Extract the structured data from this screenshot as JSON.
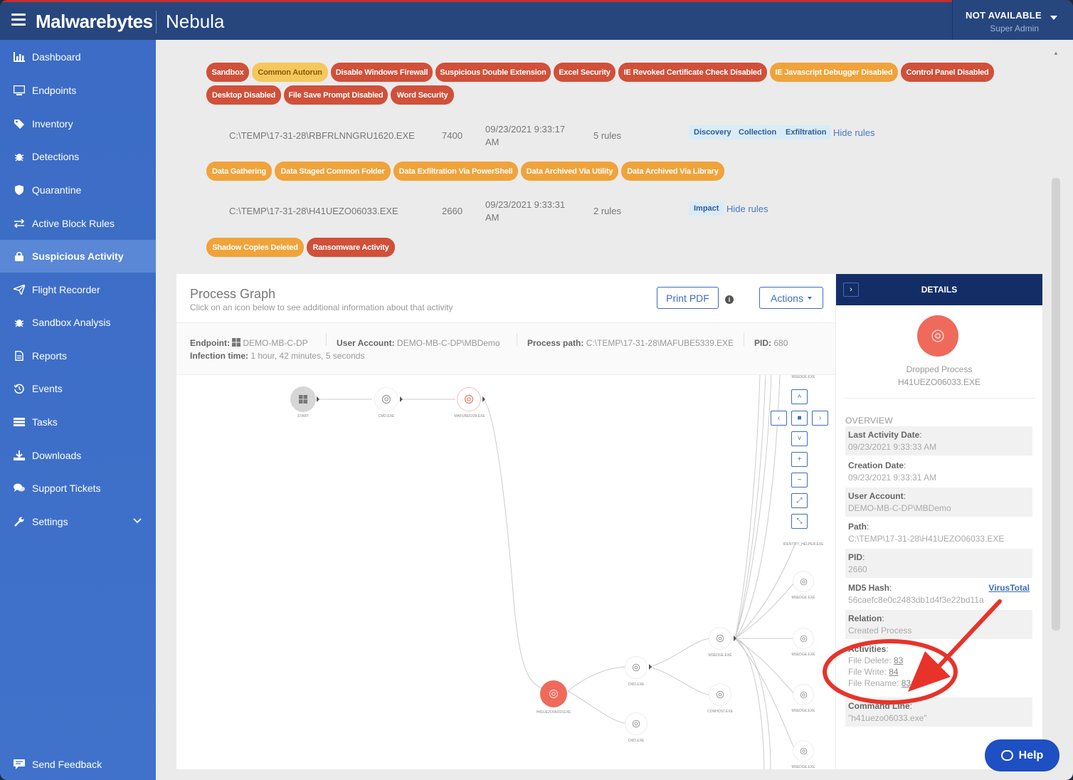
{
  "app": {
    "brand": "Malwarebytes",
    "product": "Nebula"
  },
  "user": {
    "name": "NOT AVAILABLE",
    "role": "Super Admin"
  },
  "sidebar": {
    "items": [
      {
        "label": "Dashboard",
        "icon": "chart-icon",
        "active": false
      },
      {
        "label": "Endpoints",
        "icon": "monitor-icon",
        "active": false
      },
      {
        "label": "Inventory",
        "icon": "tag-icon",
        "active": false
      },
      {
        "label": "Detections",
        "icon": "bug-icon",
        "active": false
      },
      {
        "label": "Quarantine",
        "icon": "shield-icon",
        "active": false
      },
      {
        "label": "Active Block Rules",
        "icon": "arrows-icon",
        "active": false
      },
      {
        "label": "Suspicious Activity",
        "icon": "lock-icon",
        "active": true
      },
      {
        "label": "Flight Recorder",
        "icon": "paper-plane-icon",
        "active": false
      },
      {
        "label": "Sandbox Analysis",
        "icon": "bug-icon",
        "active": false
      },
      {
        "label": "Reports",
        "icon": "document-icon",
        "active": false
      },
      {
        "label": "Events",
        "icon": "history-icon",
        "active": false
      },
      {
        "label": "Tasks",
        "icon": "list-icon",
        "active": false
      },
      {
        "label": "Downloads",
        "icon": "download-icon",
        "active": false
      },
      {
        "label": "Support Tickets",
        "icon": "chat-icon",
        "active": false
      },
      {
        "label": "Settings",
        "icon": "wrench-icon",
        "active": false
      }
    ],
    "feedback": "Send Feedback"
  },
  "rules_top": {
    "row1": [
      "Sandbox",
      "Common Autorun",
      "Disable Windows Firewall",
      "Suspicious Double Extension",
      "Excel Security",
      "IE Revoked Certificate Check Disabled",
      "IE Javascript Debugger Disabled",
      "Control Panel Disabled"
    ],
    "row2": [
      "Desktop Disabled",
      "File Save Prompt Disabled",
      "Word Security"
    ]
  },
  "process_rows": [
    {
      "path": "C:\\TEMP\\17-31-28\\RBFRLNNGRU1620.EXE",
      "pid": "7400",
      "date": "09/23/2021 9:33:17",
      "ampm": "AM",
      "rules": "5 rules",
      "tactics": [
        "Discovery",
        "Collection",
        "Exfiltration"
      ],
      "hide": "Hide rules",
      "badges": [
        "Data Gathering",
        "Data Staged Common Folder",
        "Data Exfiltration Via PowerShell",
        "Data Archived Via Utility",
        "Data Archived Via Library"
      ]
    },
    {
      "path": "C:\\TEMP\\17-31-28\\H41UEZO06033.EXE",
      "pid": "2660",
      "date": "09/23/2021 9:33:31",
      "ampm": "AM",
      "rules": "2 rules",
      "tactics": [
        "Impact"
      ],
      "hide": "Hide rules",
      "badges": [
        "Shadow Copies Deleted",
        "Ransomware Activity"
      ]
    }
  ],
  "process_graph": {
    "title": "Process Graph",
    "subtitle": "Click on an icon below to see additional information about that activity",
    "print_label": "Print PDF",
    "info_icon": "i",
    "actions_label": "Actions",
    "endpoint_label": "Endpoint:",
    "endpoint_value": "DEMO-MB-C-DP",
    "user_label": "User Account:",
    "user_value": "DEMO-MB-C-DP\\MBDemo",
    "path_label": "Process path:",
    "path_value": "C:\\TEMP\\17-31-28\\MAFUBE5339.EXE",
    "pid_label": "PID:",
    "pid_value": "680",
    "infection_label": "Infection time:",
    "infection_value": "1 hour, 42 minutes, 5 seconds",
    "node_labels": {
      "start": "START",
      "cmd1": "CMD.EXE",
      "mafube": "MAFUBE5339.EXE",
      "h41": "H41UEZO06033.EXE",
      "cmd2": "CMD.EXE",
      "cmd3": "CMD.EXE",
      "msedge1": "MSEDGE.EXE",
      "conhost": "CONHOST.EXE",
      "identity": "IDENTITY_HELPER.EXE",
      "msedge2": "MSEDGE.EXE",
      "msedge3": "MSEDGE.EXE",
      "msedge4": "MSEDGE.EXE",
      "msedge5": "MSEDGE.EXE",
      "top": "MSEDGE.EXE"
    }
  },
  "details": {
    "title": "DETAILS",
    "toggle": "›",
    "type": "Dropped Process",
    "name": "H41UEZO06033.EXE",
    "overview": "OVERVIEW",
    "fields": {
      "last_activity_label": "Last Activity Date",
      "last_activity_value": "09/23/2021 9:33:33 AM",
      "creation_label": "Creation Date",
      "creation_value": "09/23/2021 9:33:31 AM",
      "user_label": "User Account",
      "user_value": "DEMO-MB-C-DP\\MBDemo",
      "path_label": "Path",
      "path_value": "C:\\TEMP\\17-31-28\\H41UEZO06033.EXE",
      "pid_label": "PID",
      "pid_value": "2660",
      "md5_label": "MD5 Hash",
      "md5_value": "56caefc8e0c2483db1d4f3e22bd11a",
      "virustotal": "VirusTotal",
      "relation_label": "Relation",
      "relation_value": "Created Process",
      "activities_label": "Activities",
      "file_delete_label": "File Delete:",
      "file_delete_value": "83",
      "file_write_label": "File Write:",
      "file_write_value": "84",
      "file_rename_label": "File Rename:",
      "file_rename_value": "83",
      "cmd_label": "Command Line",
      "cmd_value": "\"h41uezo06033.exe\""
    }
  },
  "help": {
    "label": "Help"
  },
  "colors": {
    "topbar": "#27467e",
    "sidebar": "#3c6cc5",
    "badge_red": "#d0503a",
    "badge_orange": "#f0a33a",
    "annotation": "#e8332a",
    "details_header": "#132e67"
  }
}
